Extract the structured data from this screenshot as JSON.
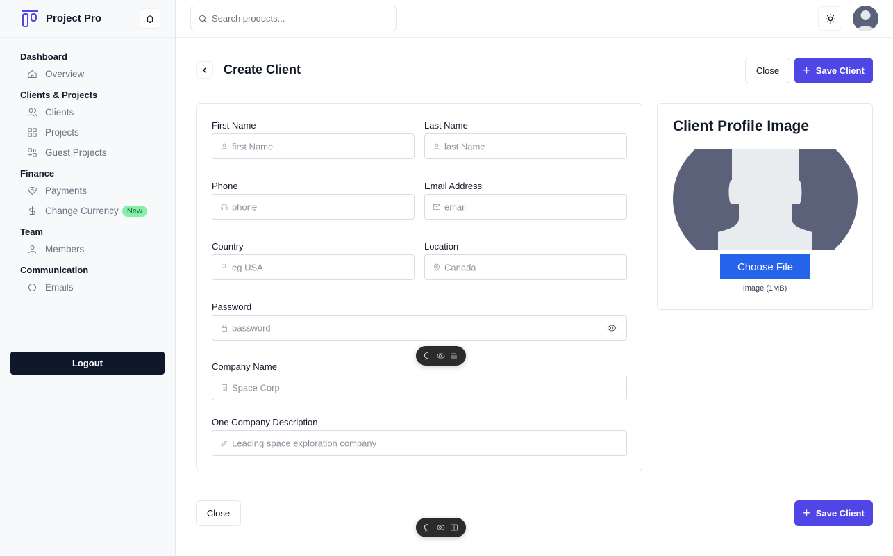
{
  "app": {
    "name": "Project Pro"
  },
  "search": {
    "placeholder": "Search products..."
  },
  "sidebar": {
    "sections": [
      {
        "title": "Dashboard",
        "items": [
          {
            "label": "Overview",
            "icon": "home-icon"
          }
        ]
      },
      {
        "title": "Clients & Projects",
        "items": [
          {
            "label": "Clients",
            "icon": "users-icon"
          },
          {
            "label": "Projects",
            "icon": "grid-icon"
          },
          {
            "label": "Guest Projects",
            "icon": "guest-grid-icon"
          }
        ]
      },
      {
        "title": "Finance",
        "items": [
          {
            "label": "Payments",
            "icon": "handshake-icon"
          },
          {
            "label": "Change Currency",
            "icon": "dollar-icon",
            "badge": "New"
          }
        ]
      },
      {
        "title": "Team",
        "items": [
          {
            "label": "Members",
            "icon": "user-icon"
          }
        ]
      },
      {
        "title": "Communication",
        "items": [
          {
            "label": "Emails",
            "icon": "mail-icon"
          }
        ]
      }
    ],
    "logout": "Logout"
  },
  "page": {
    "title": "Create Client",
    "close": "Close",
    "save": "Save Client"
  },
  "form": {
    "first_name": {
      "label": "First Name",
      "placeholder": "first Name"
    },
    "last_name": {
      "label": "Last Name",
      "placeholder": "last Name"
    },
    "phone": {
      "label": "Phone",
      "placeholder": "phone"
    },
    "email": {
      "label": "Email Address",
      "placeholder": "email"
    },
    "country": {
      "label": "Country",
      "placeholder": "eg USA"
    },
    "location": {
      "label": "Location",
      "placeholder": "Canada"
    },
    "password": {
      "label": "Password",
      "placeholder": "password"
    },
    "company": {
      "label": "Company Name",
      "placeholder": "Space Corp"
    },
    "description": {
      "label": "One Company Description",
      "placeholder": "Leading space exploration company"
    }
  },
  "profile": {
    "title": "Client Profile Image",
    "choose": "Choose File",
    "note": "Image (1MB)"
  },
  "colors": {
    "accent": "#4f46e5",
    "choose": "#2563eb",
    "logout": "#0f172a",
    "badge": "#86efac"
  }
}
